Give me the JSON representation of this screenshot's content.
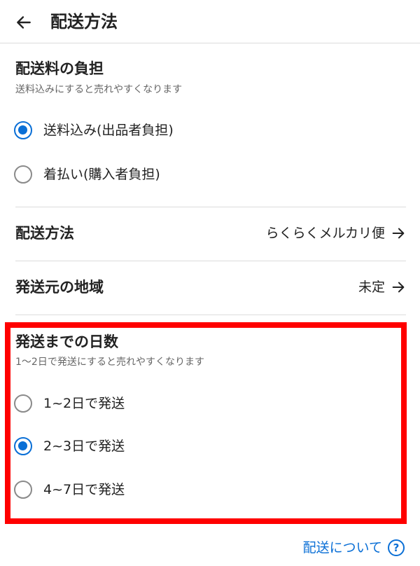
{
  "header": {
    "title": "配送方法",
    "back_icon": "arrow-left-icon"
  },
  "shipping_fee": {
    "title": "配送料の負担",
    "subtitle": "送料込みにすると売れやすくなります",
    "options": [
      {
        "label": "送料込み(出品者負担)",
        "checked": true
      },
      {
        "label": "着払い(購入者負担)",
        "checked": false
      }
    ]
  },
  "shipping_method": {
    "label": "配送方法",
    "value": "らくらくメルカリ便"
  },
  "origin_region": {
    "label": "発送元の地域",
    "value": "未定"
  },
  "days_to_ship": {
    "title": "発送までの日数",
    "subtitle": "1〜2日で発送にすると売れやすくなります",
    "options": [
      {
        "label": "1~2日で発送",
        "checked": false
      },
      {
        "label": "2~3日で発送",
        "checked": true
      },
      {
        "label": "4~7日で発送",
        "checked": false
      }
    ]
  },
  "footer": {
    "link_text": "配送について",
    "help_icon_glyph": "?"
  },
  "colors": {
    "accent": "#0a6fd6",
    "highlight": "#ff0000",
    "divider": "#dcdcdc"
  }
}
